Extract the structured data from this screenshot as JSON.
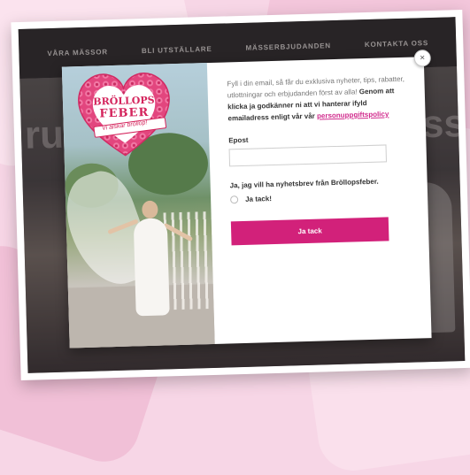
{
  "nav": {
    "items": [
      "VÅRA MÄSSOR",
      "BLI UTSTÄLLARE",
      "MÄSSERBJUDANDEN",
      "KONTAKTA OSS"
    ]
  },
  "hero": {
    "left_text": "rua",
    "right_text": "iss"
  },
  "popup": {
    "logo": {
      "line1": "BRÖLLOPS",
      "line2": "FEBER",
      "tagline": "Vi älskar bröllop!"
    },
    "intro_normal": "Fyll i din email, så får du exklusiva nyheter, tips, rabatter, utlottningar och erbjudanden först av alla!",
    "intro_bold": "Genom att klicka ja godkänner ni att vi hanterar ifyld emailadress enligt vår vår",
    "policy_link": "personuppgiftspolicy",
    "email_label": "Epost",
    "email_value": "",
    "email_placeholder": "",
    "newsletter_label": "Ja, jag vill ha nyhetsbrev från Bröllopsfeber.",
    "radio_label": "Ja tack!",
    "submit_label": "Ja tack",
    "close_symbol": "×"
  },
  "colors": {
    "accent": "#d2217a",
    "nav_bg": "#2e2a2c"
  }
}
